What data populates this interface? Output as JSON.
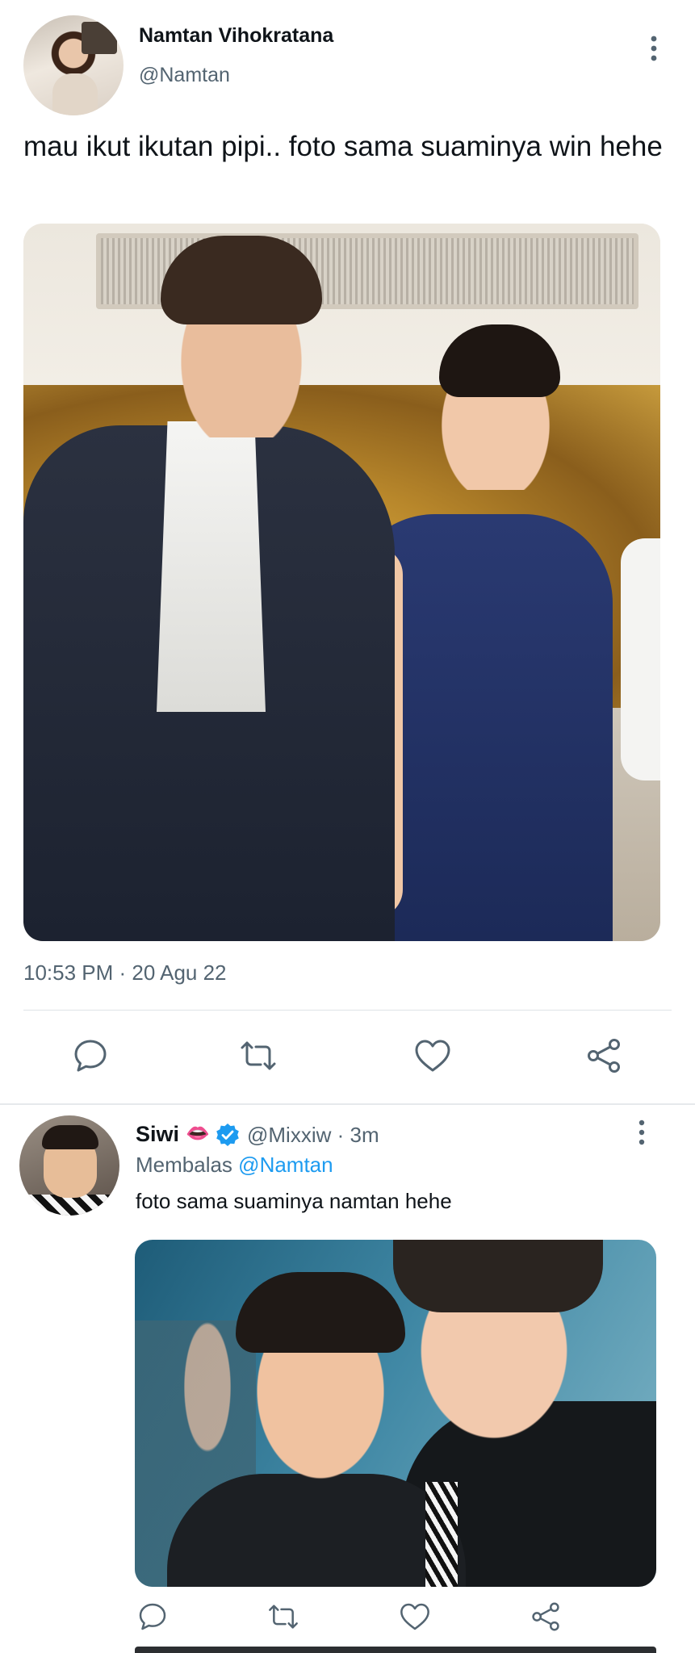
{
  "tweet": {
    "author_name": "Namtan Vihokratana",
    "author_handle": "@Namtan",
    "text": "mau ikut ikutan pipi.. foto sama suaminya win hehe",
    "timestamp": "10:53 PM · 20 Agu 22",
    "avatar_icon": "profile-photo",
    "more_icon": "more-vertical-icon",
    "actions": [
      "reply-icon",
      "retweet-icon",
      "like-icon",
      "share-icon"
    ]
  },
  "reply": {
    "author_name": "Siwi",
    "author_emoji": "👄",
    "verified_icon": "verified-badge-icon",
    "handle_time": "@Mixxiw · 3m",
    "replying_prefix": "Membalas",
    "replying_to": "@Namtan",
    "text": "foto sama suaminya namtan hehe",
    "actions": [
      "reply-icon",
      "retweet-icon",
      "like-icon",
      "share-icon"
    ]
  },
  "colors": {
    "text": "#0f1419",
    "secondary": "#536471",
    "link": "#1d9bf0",
    "icon": "#536471",
    "divider": "#dfe3e6"
  }
}
